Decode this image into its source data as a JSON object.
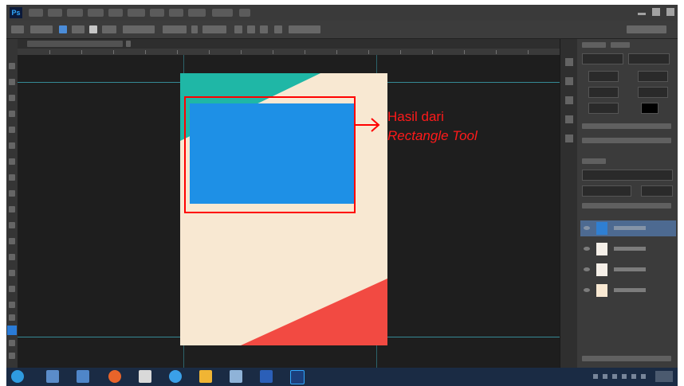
{
  "app": {
    "name": "Photoshop",
    "logo_text": "Ps"
  },
  "document": {
    "colors": {
      "background": "#f8e8d2",
      "teal": "#1fb7a6",
      "red": "#f24a42",
      "rectangle": "#1e90e6"
    },
    "shapes": [
      "top-left-teal-triangle",
      "blue-rectangle",
      "bottom-red-triangle"
    ]
  },
  "layers": {
    "items": [
      {
        "thumb_color": "#2f7fd2",
        "selected": true
      },
      {
        "thumb_color": "#f5efe8",
        "selected": false
      },
      {
        "thumb_color": "#f5efe8",
        "selected": false
      },
      {
        "thumb_color": "#f8e8d2",
        "selected": false
      }
    ]
  },
  "taskbar": {
    "icons": [
      {
        "name": "start-icon",
        "color": "#2f9be0"
      },
      {
        "name": "file-explorer-icon",
        "color": "#5b8cc9"
      },
      {
        "name": "taskview-icon",
        "color": "#4f86c9"
      },
      {
        "name": "firefox-icon",
        "color": "#e8642a"
      },
      {
        "name": "gmail-icon",
        "color": "#d9d9d9"
      },
      {
        "name": "chrome-icon",
        "color": "#3aa0e8"
      },
      {
        "name": "folder-icon",
        "color": "#f0b534"
      },
      {
        "name": "app-icon",
        "color": "#8fb3d8"
      },
      {
        "name": "word-icon",
        "color": "#2b5fb8"
      },
      {
        "name": "photoshop-taskbar-icon",
        "color": "#1b3f7c"
      }
    ]
  },
  "annotation": {
    "line1": "Hasil dari",
    "line2": "Rectangle Tool",
    "color": "#ff0000"
  }
}
